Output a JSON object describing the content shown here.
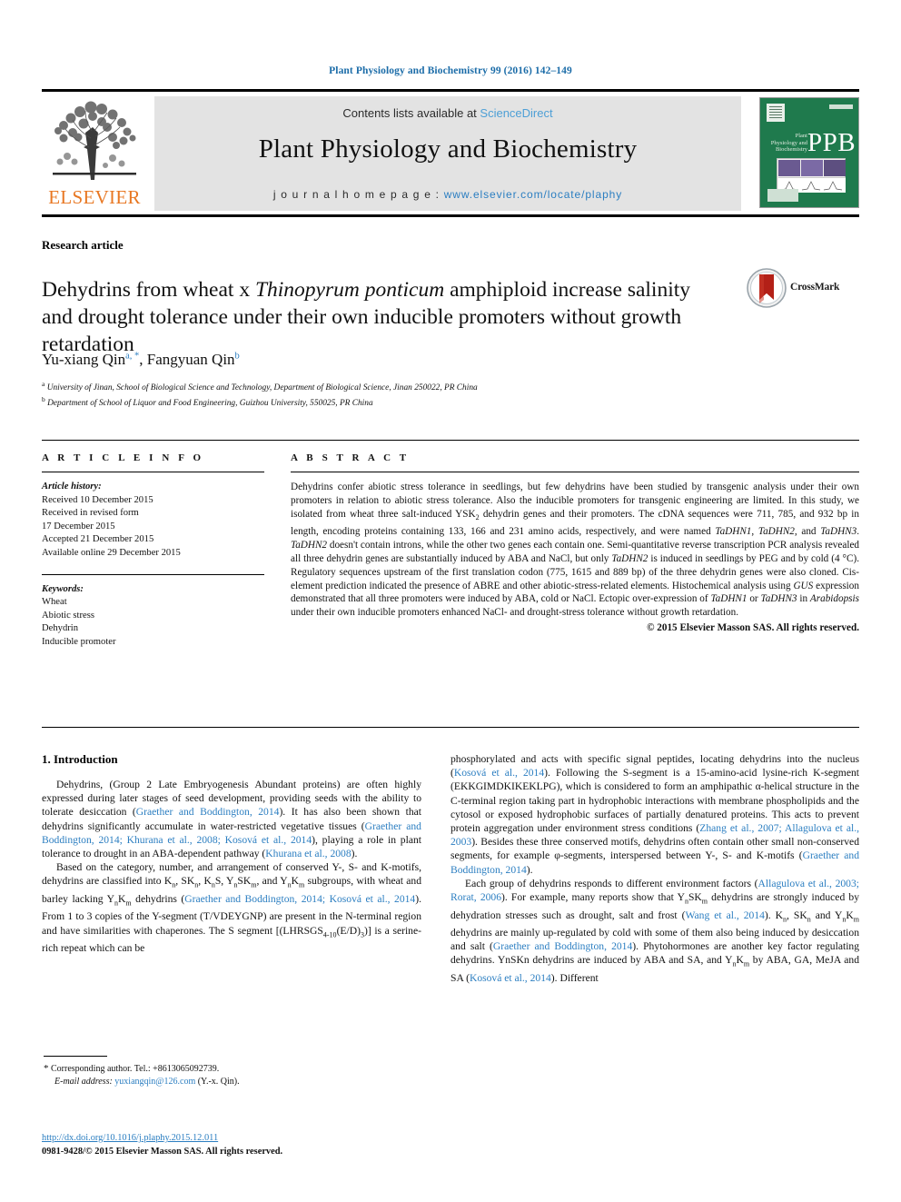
{
  "runninghead": "Plant Physiology and Biochemistry 99 (2016) 142–149",
  "masthead": {
    "contents_prefix": "Contents lists available at ",
    "contents_link": "ScienceDirect",
    "journal_name": "Plant Physiology and Biochemistry",
    "homepage_prefix": "j o u r n a l   h o m e p a g e :  ",
    "homepage_url": "www.elsevier.com/locate/plaphy",
    "publisher": "ELSEVIER",
    "publisher_logo_color": "#E87722",
    "cover": {
      "abbrev": "PPB",
      "subtitle": "Plant Physiology and Biochemistry",
      "background_color": "#1f7a4d"
    }
  },
  "article": {
    "type": "Research article",
    "title_part1": "Dehydrins from wheat x ",
    "title_italic": "Thinopyrum ponticum",
    "title_part2": " amphiploid increase salinity and drought tolerance under their own inducible promoters without growth retardation",
    "crossmark_label": "CrossMark",
    "authors": "Yu-xiang Qin",
    "author_sup_a": "a, *",
    "authors_2": ", Fangyuan Qin",
    "author_sup_b": "b",
    "affiliation_a": "University of Jinan, School of Biological Science and Technology, Department of Biological Science, Jinan 250022, PR China",
    "affiliation_b": "Department of School of Liquor and Food Engineering, Guizhou University, 550025, PR China"
  },
  "info": {
    "heading": "A R T I C L E   I N F O",
    "history_label": "Article history:",
    "history": [
      "Received 10 December 2015",
      "Received in revised form",
      "17 December 2015",
      "Accepted 21 December 2015",
      "Available online 29 December 2015"
    ],
    "keywords_label": "Keywords:",
    "keywords": [
      "Wheat",
      "Abiotic stress",
      "Dehydrin",
      "Inducible promoter"
    ]
  },
  "abstract": {
    "heading": "A B S T R A C T",
    "paragraph_1": "Dehydrins confer abiotic stress tolerance in seedlings, but few dehydrins have been studied by transgenic analysis under their own promoters in relation to abiotic stress tolerance. Also the inducible promoters for transgenic engineering are limited. In this study, we isolated from wheat three salt-induced YSK",
    "ysk_sub": "2",
    "paragraph_2": " dehydrin genes and their promoters. The cDNA sequences were 711, 785, and 932 bp in length, encoding proteins containing 133, 166 and 231 amino acids, respectively, and were named ",
    "gene_1": "TaDHN1",
    "paragraph_3": ", ",
    "gene_2": "TaDHN2",
    "paragraph_4": ", and ",
    "gene_3": "TaDHN3",
    "paragraph_5": ". ",
    "gene_4": "TaDHN2",
    "paragraph_6": " doesn't contain introns, while the other two genes each contain one. Semi-quantitative reverse transcription PCR analysis revealed all three dehydrin genes are substantially induced by ABA and NaCl, but only ",
    "gene_5": "TaDHN2",
    "paragraph_7": " is induced in seedlings by PEG and by cold (4 °C). Regulatory sequences upstream of the first translation codon (775, 1615 and 889 bp) of the three dehydrin genes were also cloned. Cis-element prediction indicated the presence of ABRE and other abiotic-stress-related elements. Histochemical analysis using ",
    "gene_6": "GUS",
    "paragraph_8": " expression demonstrated that all three promoters were induced by ABA, cold or NaCl. Ectopic over-expression of ",
    "gene_7": "TaDHN1",
    "paragraph_9": " or ",
    "gene_8": "TaDHN3",
    "paragraph_10": " in ",
    "gene_9": "Arabidopsis",
    "paragraph_11": " under their own inducible promoters enhanced NaCl- and drought-stress tolerance without growth retardation.",
    "copyright": "© 2015 Elsevier Masson SAS. All rights reserved."
  },
  "body": {
    "section_title": "1.  Introduction",
    "left": {
      "p1_a": "Dehydrins, (Group 2 Late Embryogenesis Abundant proteins) are often highly expressed during later stages of seed development, providing seeds with the ability to tolerate desiccation (",
      "p1_ref1": "Graether and Boddington, 2014",
      "p1_b": "). It has also been shown that dehydrins significantly accumulate in water-restricted vegetative tissues (",
      "p1_ref2": "Graether and Boddington, 2014; Khurana et al., 2008; Kosová et al., 2014",
      "p1_c": "), playing a role in plant tolerance to drought in an ABA-dependent pathway (",
      "p1_ref3": "Khurana et al., 2008",
      "p1_d": ").",
      "p2_a": "Based on the category, number, and arrangement of conserved Y-, S- and K-motifs, dehydrins are classified into K",
      "p2_sub1": "n",
      "p2_b": ", SK",
      "p2_sub2": "n",
      "p2_c": ", K",
      "p2_sub3": "n",
      "p2_d": "S, Y",
      "p2_sub4": "n",
      "p2_e": "SK",
      "p2_sub5": "m",
      "p2_f": ", and Y",
      "p2_sub6": "n",
      "p2_g": "K",
      "p2_sub7": "m",
      "p2_h": " subgroups, with wheat and barley lacking Y",
      "p2_sub8": "n",
      "p2_i": "K",
      "p2_sub9": "m",
      "p2_j": " dehydrins (",
      "p2_ref1": "Graether and Boddington, 2014; Kosová et al., 2014",
      "p2_k": "). From 1 to 3 copies of the Y-segment (T/VDEYGNP) are present in the N-terminal region and have similarities with chaperones. The S segment [(LHRSGS",
      "p2_sub10": "4-10",
      "p2_l": "(E/D)",
      "p2_sub11": "3",
      "p2_m": ")] is a serine-rich repeat which can be"
    },
    "right": {
      "p1_a": "phosphorylated and acts with specific signal peptides, locating dehydrins into the nucleus (",
      "p1_ref1": "Kosová et al., 2014",
      "p1_b": "). Following the S-segment is a 15-amino-acid lysine-rich K-segment (EKKGIMDKIKEKLPG), which is considered to form an amphipathic α-helical structure in the C-terminal region taking part in hydrophobic interactions with membrane phospholipids and the cytosol or exposed hydrophobic surfaces of partially denatured proteins. This acts to prevent protein aggregation under environment stress conditions (",
      "p1_ref2": "Zhang et al., 2007; Allagulova et al., 2003",
      "p1_c": "). Besides these three conserved motifs, dehydrins often contain other small non-conserved segments, for example φ-segments, interspersed between Y-, S- and K-motifs (",
      "p1_ref3": "Graether and Boddington, 2014",
      "p1_d": ").",
      "p2_a": "Each group of dehydrins responds to different environment factors (",
      "p2_ref1": "Allagulova et al., 2003; Rorat, 2006",
      "p2_b": "). For example, many reports show that Y",
      "p2_sub1": "n",
      "p2_c": "SK",
      "p2_sub2": "m",
      "p2_d": " dehydrins are strongly induced by dehydration stresses such as drought, salt and frost (",
      "p2_ref2": "Wang et al., 2014",
      "p2_e": "). K",
      "p2_sub3": "n",
      "p2_f": ", SK",
      "p2_sub4": "n",
      "p2_g": " and Y",
      "p2_sub5": "n",
      "p2_h": "K",
      "p2_sub6": "m",
      "p2_i": " dehydrins are mainly up-regulated by cold with some of them also being induced by desiccation and salt (",
      "p2_ref3": "Graether and Boddington, 2014",
      "p2_j": "). Phytohormones are another key factor regulating dehydrins. YnSKn dehydrins are induced by ABA and SA, and Y",
      "p2_sub7": "n",
      "p2_k": "K",
      "p2_sub8": "m",
      "p2_l": " by ABA, GA, MeJA and SA (",
      "p2_ref4": "Kosová et al., 2014",
      "p2_m": "). Different"
    }
  },
  "footnotes": {
    "star": "*",
    "corresponding": " Corresponding author. Tel.: +8613065092739.",
    "email_label": "E-mail address:",
    "email": "yuxiangqin@126.com",
    "email_suffix": " (Y.-x. Qin)."
  },
  "footer": {
    "doi": "http://dx.doi.org/10.1016/j.plaphy.2015.12.011",
    "issn": "0981-9428/© 2015 Elsevier Masson SAS. All rights reserved."
  },
  "colors": {
    "link": "#2b7ec1",
    "sciencedirect": "#4d9fd6",
    "elsevier_orange": "#E87722",
    "cover_green": "#1f7a4d",
    "runhead_blue": "#1b6ca8"
  }
}
